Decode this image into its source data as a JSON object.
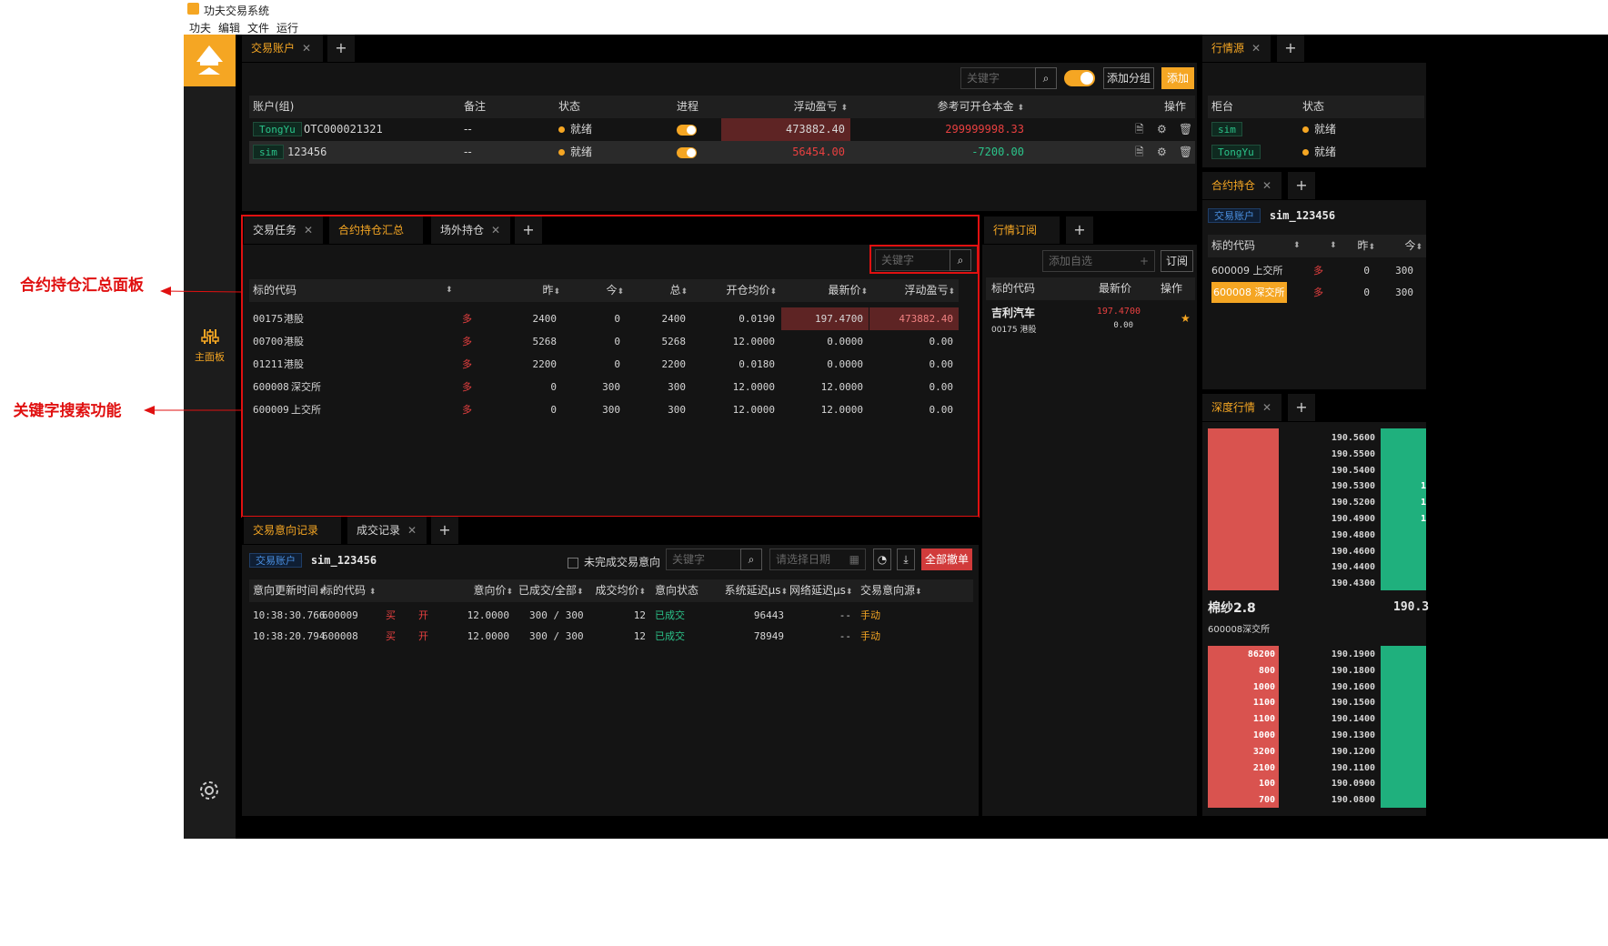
{
  "window": {
    "title": "功夫交易系统",
    "menu": [
      "功夫",
      "编辑",
      "文件",
      "运行"
    ]
  },
  "nav": {
    "main_label": "主面板"
  },
  "annotations": {
    "panel_label": "合约持仓汇总面板",
    "search_label": "关键字搜索功能"
  },
  "accounts_panel": {
    "tabs": [
      "交易账户"
    ],
    "search_placeholder": "关键字",
    "add_group_label": "添加分组",
    "add_label": "添加",
    "columns": [
      "账户(组)",
      "备注",
      "状态",
      "进程",
      "浮动盈亏",
      "参考可开仓本金",
      "操作"
    ],
    "rows": [
      {
        "broker": "TongYu",
        "account": "OTC000021321",
        "note": "--",
        "status": "就绪",
        "pnl": "473882.40",
        "capital": "299999998.33"
      },
      {
        "broker": "sim",
        "account": "123456",
        "note": "--",
        "status": "就绪",
        "pnl": "56454.00",
        "capital": "-7200.00"
      }
    ]
  },
  "market_source_panel": {
    "tab": "行情源",
    "columns": [
      "柜台",
      "状态"
    ],
    "rows": [
      {
        "broker": "sim",
        "status": "就绪"
      },
      {
        "broker": "TongYu",
        "status": "就绪"
      }
    ]
  },
  "positions_panel": {
    "tabs": [
      "交易任务",
      "合约持仓汇总",
      "场外持仓"
    ],
    "search_placeholder": "关键字",
    "columns": [
      "标的代码",
      "",
      "昨",
      "今",
      "总",
      "开仓均价",
      "最新价",
      "浮动盈亏"
    ],
    "rows": [
      {
        "code": "00175",
        "exch": "港股",
        "dir": "多",
        "yd": "2400",
        "td": "0",
        "total": "2400",
        "avg": "0.0190",
        "last": "197.4700",
        "pnl": "473882.40"
      },
      {
        "code": "00700",
        "exch": "港股",
        "dir": "多",
        "yd": "5268",
        "td": "0",
        "total": "5268",
        "avg": "12.0000",
        "last": "0.0000",
        "pnl": "0.00"
      },
      {
        "code": "01211",
        "exch": "港股",
        "dir": "多",
        "yd": "2200",
        "td": "0",
        "total": "2200",
        "avg": "0.0180",
        "last": "0.0000",
        "pnl": "0.00"
      },
      {
        "code": "600008",
        "exch": "深交所",
        "dir": "多",
        "yd": "0",
        "td": "300",
        "total": "300",
        "avg": "12.0000",
        "last": "12.0000",
        "pnl": "0.00"
      },
      {
        "code": "600009",
        "exch": "上交所",
        "dir": "多",
        "yd": "0",
        "td": "300",
        "total": "300",
        "avg": "12.0000",
        "last": "12.0000",
        "pnl": "0.00"
      }
    ]
  },
  "subscribe_panel": {
    "tab": "行情订阅",
    "add_placeholder": "添加自选",
    "subscribe_label": "订阅",
    "columns": [
      "标的代码",
      "最新价",
      "操作"
    ],
    "rows": [
      {
        "name": "吉利汽车",
        "code": "00175 港股",
        "price": "197.4700",
        "change": "0.00"
      }
    ]
  },
  "contract_positions_panel": {
    "tab": "合约持仓",
    "account_tag": "交易账户",
    "account": "sim_123456",
    "columns": [
      "标的代码",
      "",
      "昨",
      "今"
    ],
    "rows": [
      {
        "code": "600009 上交所",
        "dir": "多",
        "yd": "0",
        "td": "300",
        "highlight": false
      },
      {
        "code": "600008 深交所",
        "dir": "多",
        "yd": "0",
        "td": "300",
        "highlight": true
      }
    ]
  },
  "orders_panel": {
    "tabs": [
      "交易意向记录",
      "成交记录"
    ],
    "account_tag": "交易账户",
    "account": "sim_123456",
    "unfinished_label": "未完成交易意向",
    "search_placeholder": "关键字",
    "date_placeholder": "请选择日期",
    "cancel_all_label": "全部撤单",
    "columns": [
      "意向更新时间",
      "标的代码",
      "",
      "",
      "意向价",
      "已成交/全部",
      "成交均价",
      "意向状态",
      "系统延迟μs",
      "网络延迟μs",
      "交易意向源"
    ],
    "rows": [
      {
        "time": "10:38:30.766",
        "code": "600009",
        "side": "买",
        "offset": "开",
        "price": "12.0000",
        "filled": "300 / 300",
        "avg": "12",
        "status": "已成交",
        "sys_lat": "96443",
        "net_lat": "--",
        "source": "手动"
      },
      {
        "time": "10:38:20.794",
        "code": "600008",
        "side": "买",
        "offset": "开",
        "price": "12.0000",
        "filled": "300 / 300",
        "avg": "12",
        "status": "已成交",
        "sys_lat": "78949",
        "net_lat": "--",
        "source": "手动"
      }
    ]
  },
  "depth_panel": {
    "tab": "深度行情",
    "ask_prices": [
      "190.5600",
      "190.5500",
      "190.5400",
      "190.5300",
      "190.5200",
      "190.4900",
      "190.4800",
      "190.4600",
      "190.4400",
      "190.4300"
    ],
    "ask_right_digits": [
      "",
      "",
      "",
      "1",
      "1",
      "1",
      "",
      "",
      "",
      ""
    ],
    "name": "棉纱2.8",
    "code": "600008深交所",
    "last": "190.3",
    "bid_volumes": [
      "86200",
      "800",
      "1000",
      "1100",
      "1100",
      "1000",
      "3200",
      "2100",
      "100",
      "700"
    ],
    "bid_prices": [
      "190.1900",
      "190.1800",
      "190.1600",
      "190.1500",
      "190.1400",
      "190.1300",
      "190.1200",
      "190.1100",
      "190.0900",
      "190.0800"
    ]
  },
  "colors": {
    "accent": "#f5a623",
    "up": "#e84040",
    "down": "#2bc48a",
    "annotation": "#e01010"
  }
}
